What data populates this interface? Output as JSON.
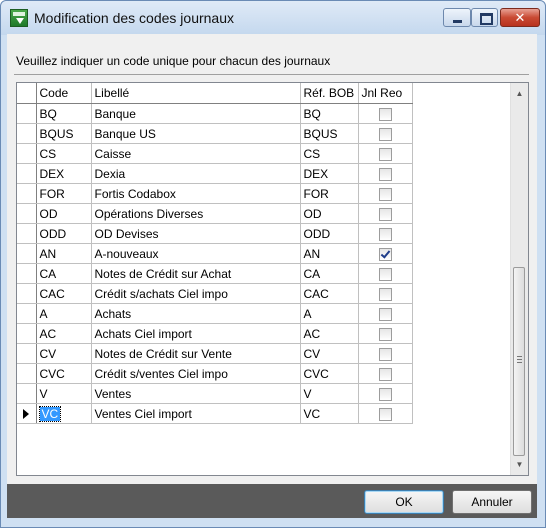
{
  "window": {
    "title": "Modification des codes journaux",
    "controls": {
      "minimize": "minimize",
      "maximize": "maximize",
      "close": "✕"
    }
  },
  "instruction": "Veuillez indiquer un code unique pour chacun des journaux",
  "grid": {
    "columns": [
      "Code",
      "Libellé",
      "Réf. BOB",
      "Jnl Reo"
    ],
    "rows": [
      {
        "code": "BQ",
        "libelle": "Banque",
        "ref": "BQ",
        "reo": false
      },
      {
        "code": "BQUS",
        "libelle": "Banque US",
        "ref": "BQUS",
        "reo": false
      },
      {
        "code": "CS",
        "libelle": "Caisse",
        "ref": "CS",
        "reo": false
      },
      {
        "code": "DEX",
        "libelle": "Dexia",
        "ref": "DEX",
        "reo": false
      },
      {
        "code": "FOR",
        "libelle": "Fortis Codabox",
        "ref": "FOR",
        "reo": false
      },
      {
        "code": "OD",
        "libelle": "Opérations Diverses",
        "ref": "OD",
        "reo": false
      },
      {
        "code": "ODD",
        "libelle": "OD Devises",
        "ref": "ODD",
        "reo": false
      },
      {
        "code": "AN",
        "libelle": "A-nouveaux",
        "ref": "AN",
        "reo": true
      },
      {
        "code": "CA",
        "libelle": "Notes de Crédit sur Achat",
        "ref": "CA",
        "reo": false
      },
      {
        "code": "CAC",
        "libelle": "Crédit s/achats Ciel impo",
        "ref": "CAC",
        "reo": false
      },
      {
        "code": "A",
        "libelle": "Achats",
        "ref": "A",
        "reo": false
      },
      {
        "code": "AC",
        "libelle": "Achats Ciel import",
        "ref": "AC",
        "reo": false
      },
      {
        "code": "CV",
        "libelle": "Notes de Crédit sur Vente",
        "ref": "CV",
        "reo": false
      },
      {
        "code": "CVC",
        "libelle": "Crédit s/ventes Ciel impo",
        "ref": "CVC",
        "reo": false
      },
      {
        "code": "V",
        "libelle": "Ventes",
        "ref": "V",
        "reo": false
      },
      {
        "code": "VC",
        "libelle": "Ventes Ciel import",
        "ref": "VC",
        "reo": false
      }
    ],
    "current_row_code": "VC"
  },
  "buttons": {
    "ok": "OK",
    "cancel": "Annuler"
  },
  "icons": {
    "app": "journal-app-icon",
    "row_pointer": "row-pointer-icon",
    "scroll_up": "scroll-up-arrow-icon",
    "scroll_down": "scroll-down-arrow-icon"
  }
}
